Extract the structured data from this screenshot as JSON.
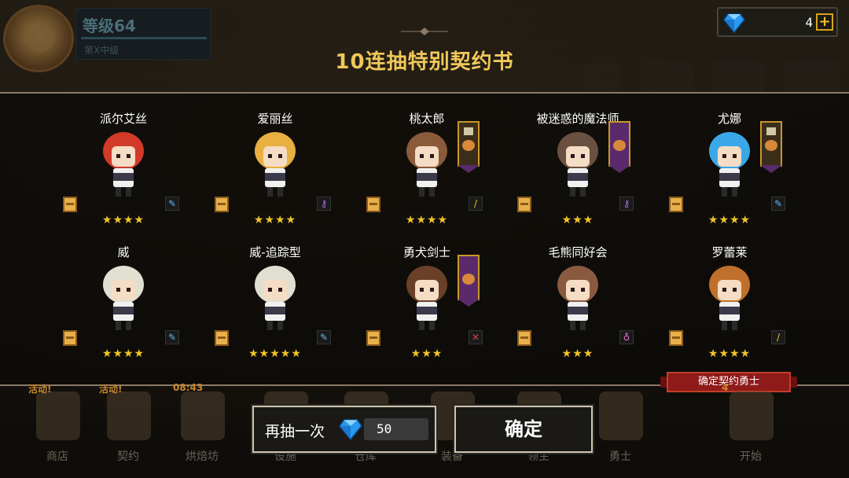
{
  "player": {
    "level": "等级64",
    "subtitle": "第X中级"
  },
  "currency": {
    "gems": "4",
    "plus": "+"
  },
  "title": "10连抽特别契约书",
  "heroes_row1": [
    {
      "name": "派尔艾丝",
      "stars": "★★★★",
      "cls": "✎",
      "cls_color": "#5ab8f0",
      "hair": "#d23a2a",
      "banner": false
    },
    {
      "name": "爱丽丝",
      "stars": "★★★★",
      "cls": "⚷",
      "cls_color": "#b070e0",
      "hair": "#e8b040",
      "banner": false
    },
    {
      "name": "桃太郎",
      "stars": "★★★★",
      "cls": "/",
      "cls_color": "#f0c030",
      "hair": "#8a5a3a",
      "banner": "brown"
    },
    {
      "name": "被迷惑的魔法师",
      "stars": "★★★",
      "cls": "⚷",
      "cls_color": "#b070e0",
      "hair": "#6a5040",
      "banner": "purple"
    },
    {
      "name": "尤娜",
      "stars": "★★★★",
      "cls": "✎",
      "cls_color": "#5ab8f0",
      "hair": "#3aa8e8",
      "banner": "brown"
    }
  ],
  "heroes_row2": [
    {
      "name": "威",
      "stars": "★★★★",
      "cls": "✎",
      "cls_color": "#5ab8f0",
      "hair": "#e0e0d0",
      "banner": false
    },
    {
      "name": "威-追踪型",
      "stars": "★★★★★",
      "cls": "✎",
      "cls_color": "#5ab8f0",
      "hair": "#e0e0d0",
      "banner": false
    },
    {
      "name": "勇犬剑士",
      "stars": "★★★",
      "cls": "✕",
      "cls_color": "#e04040",
      "hair": "#6a4028",
      "banner": "purple"
    },
    {
      "name": "毛熊同好会",
      "stars": "★★★",
      "cls": "♁",
      "cls_color": "#e070c0",
      "hair": "#8a5a40",
      "banner": false
    },
    {
      "name": "罗蕾莱",
      "stars": "★★★★",
      "cls": "/",
      "cls_color": "#f0c030",
      "hair": "#c0702a",
      "banner": false
    }
  ],
  "confirm_tag": "确定契约勇士",
  "nav": [
    {
      "label": "商店",
      "hot": "活动!"
    },
    {
      "label": "契约",
      "hot": "活动!"
    },
    {
      "label": "烘焙坊",
      "hot": "08:43"
    },
    {
      "label": "设施",
      "hot": ""
    },
    {
      "label": "仓库",
      "hot": ""
    },
    {
      "label": "装备",
      "hot": ""
    },
    {
      "label": "领主",
      "hot": ""
    },
    {
      "label": "勇士",
      "hot": ""
    },
    {
      "label": "开始",
      "hot": "4"
    }
  ],
  "buttons": {
    "again_label": "再抽一次",
    "again_cost": "50",
    "ok_label": "确定"
  }
}
